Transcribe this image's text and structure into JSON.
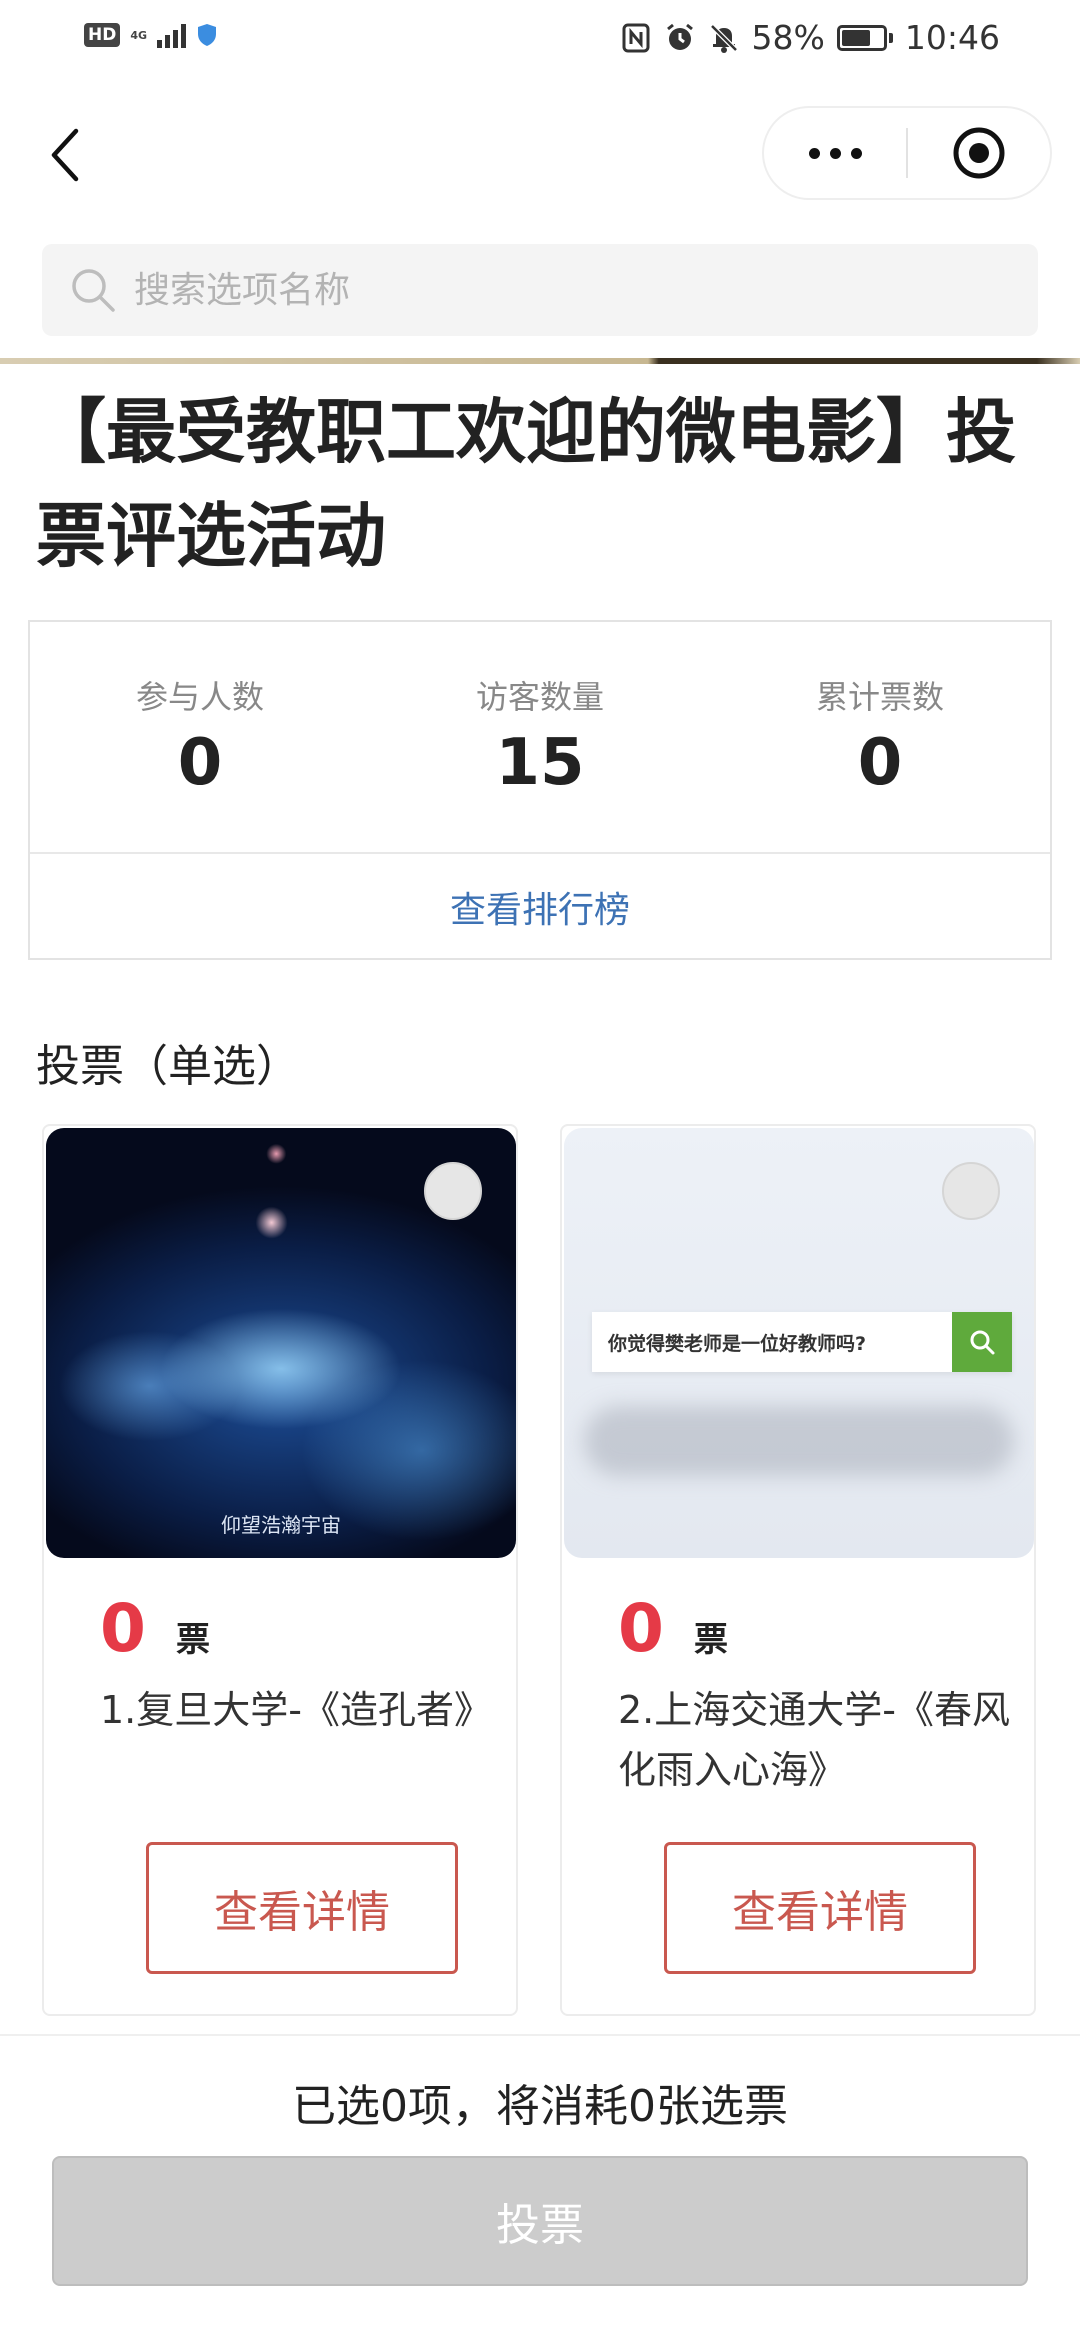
{
  "status_bar": {
    "hd": "HD",
    "network": "4G",
    "battery": "58%",
    "time": "10:46"
  },
  "nav": {
    "icons": [
      "back-icon",
      "more-icon",
      "target-icon"
    ]
  },
  "search": {
    "placeholder": "搜索选项名称"
  },
  "title": "【最受教职工欢迎的微电影】投票评选活动",
  "stats": {
    "participants_label": "参与人数",
    "participants_value": "0",
    "visitors_label": "访客数量",
    "visitors_value": "15",
    "total_votes_label": "累计票数",
    "total_votes_value": "0",
    "ranking_link": "查看排行榜"
  },
  "section_title": "投票（单选）",
  "options": [
    {
      "votes": "0",
      "unit": "票",
      "name": "1.复旦大学-《造孔者》",
      "image_caption": "仰望浩瀚宇宙",
      "detail_label": "查看详情"
    },
    {
      "votes": "0",
      "unit": "票",
      "name": "2.上海交通大学-《春风化雨入心海》",
      "image_caption": "你觉得樊老师是一位好教师吗?",
      "detail_label": "查看详情"
    }
  ],
  "bottom": {
    "summary": "已选0项，将消耗0张选票",
    "vote_label": "投票"
  },
  "colors": {
    "vote_count": "#e53a47",
    "detail_button": "#c9584f",
    "link": "#3d72b4",
    "disabled_button": "#cccccc"
  }
}
